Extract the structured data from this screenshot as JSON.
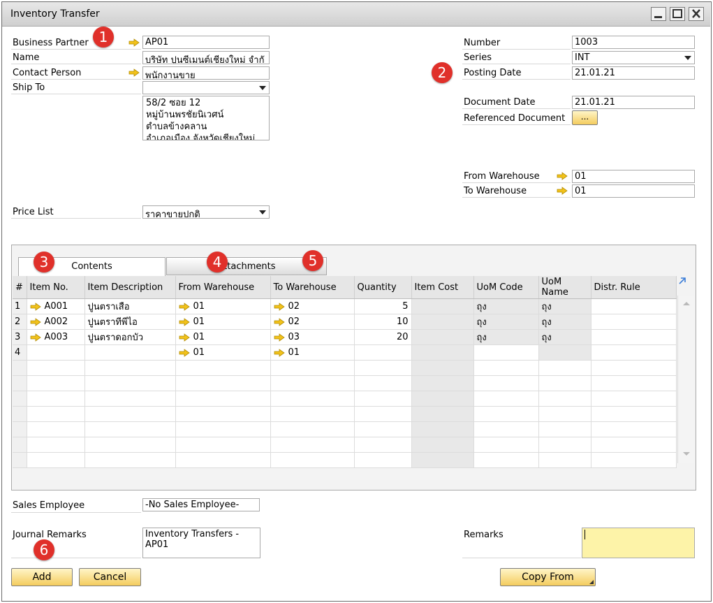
{
  "window": {
    "title": "Inventory Transfer"
  },
  "badges": [
    "1",
    "2",
    "3",
    "4",
    "5",
    "6"
  ],
  "left": {
    "business_partner_label": "Business Partner",
    "business_partner_value": "AP01",
    "name_label": "Name",
    "name_value": "บริษัท ปูนซีเมนต์เชียงใหม่ จำกั",
    "contact_label": "Contact Person",
    "contact_value": "พนักงานขาย",
    "ship_to_label": "Ship To",
    "ship_to_value": "",
    "address_lines": [
      "58/2 ซอย 12",
      "หมู่บ้านพรชัยนิเวศน์",
      "ตำบลข้างคลาน",
      "อำเภอเมือง  จังหวัดเชียงใหม่"
    ],
    "price_list_label": "Price List",
    "price_list_value": "ราคาขายปกติ"
  },
  "right": {
    "number_label": "Number",
    "number_value": "1003",
    "series_label": "Series",
    "series_value": "INT",
    "posting_date_label": "Posting Date",
    "posting_date_value": "21.01.21",
    "document_date_label": "Document Date",
    "document_date_value": "21.01.21",
    "referenced_document_label": "Referenced Document",
    "referenced_document_button": "...",
    "from_warehouse_label": "From Warehouse",
    "from_warehouse_value": "01",
    "to_warehouse_label": "To Warehouse",
    "to_warehouse_value": "01"
  },
  "tabs": [
    {
      "label": "Contents",
      "active": true
    },
    {
      "label": "Attachments",
      "active": false
    }
  ],
  "grid": {
    "columns": [
      "#",
      "Item No.",
      "Item Description",
      "From Warehouse",
      "To Warehouse",
      "Quantity",
      "Item Cost",
      "UoM Code",
      "UoM Name",
      "Distr. Rule"
    ],
    "rows": [
      {
        "num": "1",
        "item_no": "A001",
        "desc": "ปูนตราเสือ",
        "from_wh": "01",
        "to_wh": "02",
        "qty": "5",
        "cost": "",
        "uom_code": "ถุง",
        "uom_name": "ถุง",
        "distr": ""
      },
      {
        "num": "2",
        "item_no": "A002",
        "desc": "ปูนตราทีพีไอ",
        "from_wh": "01",
        "to_wh": "02",
        "qty": "10",
        "cost": "",
        "uom_code": "ถุง",
        "uom_name": "ถุง",
        "distr": ""
      },
      {
        "num": "3",
        "item_no": "A003",
        "desc": "ปูนตราดอกบัว",
        "from_wh": "01",
        "to_wh": "03",
        "qty": "20",
        "cost": "",
        "uom_code": "ถุง",
        "uom_name": "ถุง",
        "distr": ""
      },
      {
        "num": "4",
        "item_no": "",
        "desc": "",
        "from_wh": "01",
        "to_wh": "01",
        "qty": "",
        "cost": "",
        "uom_code": "",
        "uom_name": "",
        "distr": ""
      }
    ]
  },
  "bottom": {
    "sales_employee_label": "Sales Employee",
    "sales_employee_value": "-No Sales Employee-",
    "journal_remarks_label": "Journal Remarks",
    "journal_remarks_value": "Inventory Transfers - AP01",
    "remarks_label": "Remarks",
    "remarks_value": "",
    "add_button": "Add",
    "cancel_button": "Cancel",
    "copy_from_button": "Copy From"
  },
  "colors": {
    "badge": "#e0302a",
    "button": "#f4cc5e",
    "remarks_bg": "#fdf3a8",
    "arrow": "#f2c21b"
  }
}
